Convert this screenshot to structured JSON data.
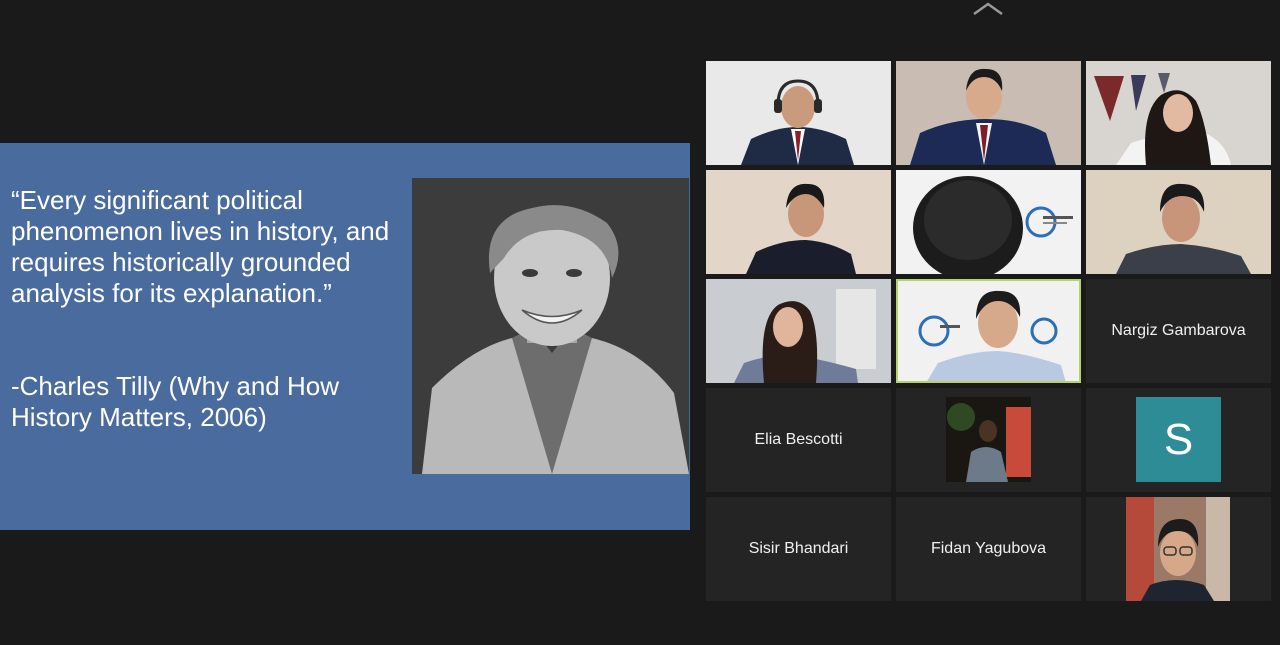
{
  "slide": {
    "quote": "“Every significant political phenomenon lives in history, and requires historically grounded analysis for its explanation.”",
    "attribution": "-Charles Tilly (Why and How History Matters, 2006)"
  },
  "participants": {
    "nargiz": "Nargiz Gambarova",
    "elia": "Elia Bescotti",
    "avatar_initial": "S",
    "sisir": "Sisir Bhandari",
    "fidan": "Fidan Yagubova"
  },
  "colors": {
    "slide_background": "#4a6b9e",
    "avatar_background": "#2e8c96",
    "active_speaker_border": "#b4d46a",
    "tile_background": "#242424"
  }
}
